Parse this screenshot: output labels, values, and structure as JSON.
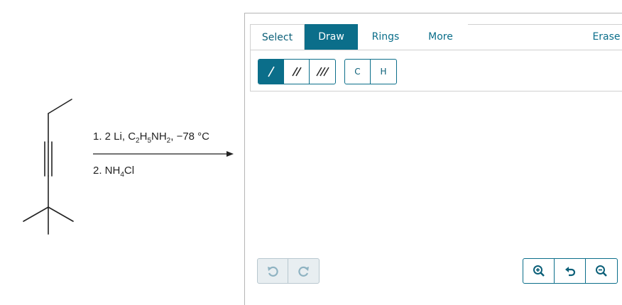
{
  "reaction": {
    "step1": {
      "prefix": "1. 2 Li, C",
      "sub1": "2",
      "mid1": "H",
      "sub2": "5",
      "mid2": "NH",
      "sub3": "2",
      "suffix": ", −78 °C"
    },
    "step2": {
      "prefix": "2. NH",
      "sub1": "4",
      "suffix": "Cl"
    }
  },
  "tabs": {
    "select": "Select",
    "draw": "Draw",
    "rings": "Rings",
    "more": "More",
    "erase": "Erase",
    "active": "draw"
  },
  "toolbar": {
    "bonds": [
      "single-bond-icon",
      "double-bond-icon",
      "triple-bond-icon"
    ],
    "active_bond": "single",
    "atoms": [
      "C",
      "H"
    ]
  },
  "bottom": {
    "history": [
      "undo-icon",
      "redo-icon"
    ],
    "zoom": [
      "zoom-in-icon",
      "zoom-reset-icon",
      "zoom-out-icon"
    ]
  },
  "colors": {
    "accent": "#0b6e8a",
    "disabled": "#e8eef1"
  }
}
